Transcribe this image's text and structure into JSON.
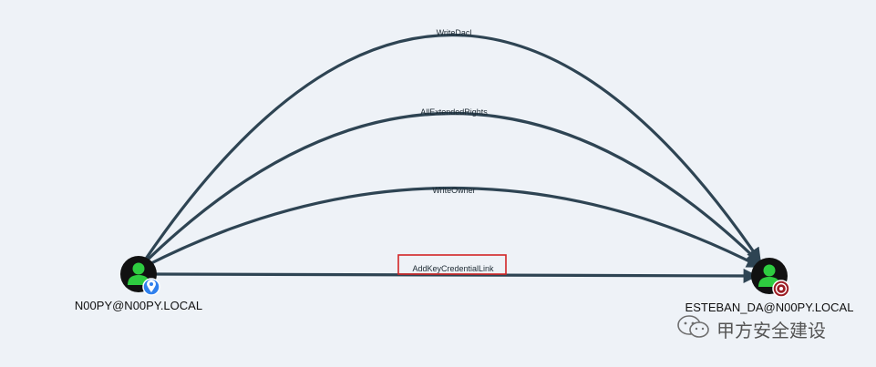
{
  "graph": {
    "source": {
      "label": "N00PY@N00PY.LOCAL",
      "icon": "user-icon",
      "badge": "location-pin-icon",
      "colors": {
        "body": "#111111",
        "figure": "#2ecc40",
        "badge": "#2f80ed"
      }
    },
    "target": {
      "label": "ESTEBAN_DA@N00PY.LOCAL",
      "icon": "user-icon",
      "badge": "target-icon",
      "colors": {
        "body": "#111111",
        "figure": "#2ecc40",
        "badge": "#9b1c24"
      }
    },
    "edges": [
      {
        "label": "WriteDacl"
      },
      {
        "label": "AllExtendedRights"
      },
      {
        "label": "WriteOwner"
      },
      {
        "label": "AddKeyCredentialLink",
        "highlighted": true
      }
    ],
    "edge_color": "#2e4453",
    "highlight_color": "#d32626"
  },
  "watermark": {
    "text": "甲方安全建设",
    "icon": "wechat-icon"
  }
}
